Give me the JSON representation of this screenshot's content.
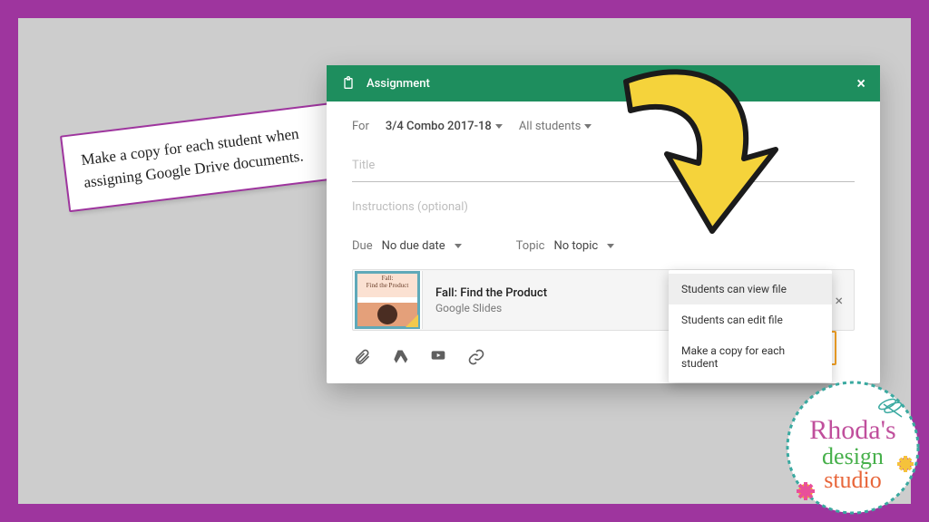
{
  "note_text": "Make a copy for each student when assigning Google Drive documents.",
  "modal": {
    "header_title": "Assignment",
    "for_label": "For",
    "class_name": "3/4 Combo 2017-18",
    "audience": "All students",
    "title_placeholder": "Title",
    "instructions_placeholder": "Instructions (optional)",
    "due_label": "Due",
    "due_value": "No due date",
    "topic_label": "Topic",
    "topic_value": "No topic",
    "attachment_thumb_line1": "Fall:",
    "attachment_thumb_line2": "Find the Product",
    "attachment_name": "Fall: Find the Product",
    "attachment_type": "Google Slides",
    "perm_options": {
      "view": "Students can view file",
      "edit": "Students can edit file",
      "copy": "Make a copy for each student"
    }
  },
  "logo": {
    "line1": "Rhoda's",
    "line2": "design",
    "line3": "studio"
  }
}
